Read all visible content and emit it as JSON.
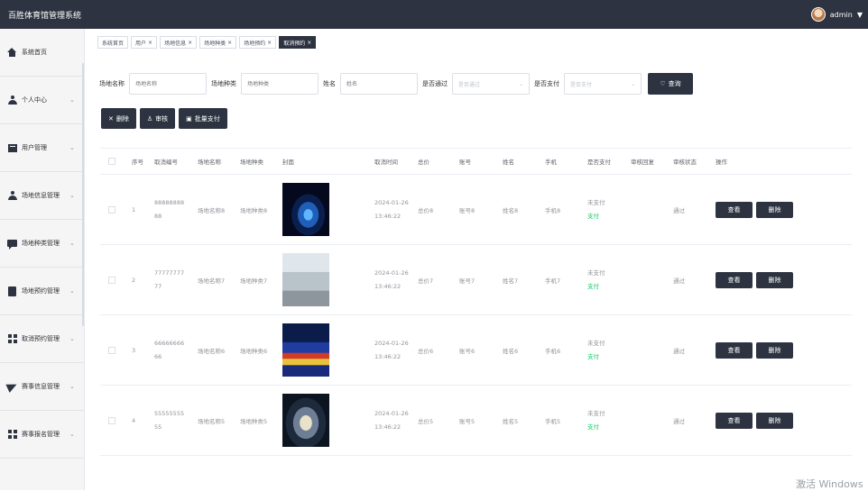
{
  "app": {
    "title": "百胜体育馆管理系统",
    "user": "admin"
  },
  "sidebar": {
    "items": [
      {
        "label": "系统首页",
        "icon": "home-icon"
      },
      {
        "label": "个人中心",
        "icon": "user-icon"
      },
      {
        "label": "用户管理",
        "icon": "folder-icon"
      },
      {
        "label": "场地信息管理",
        "icon": "user-icon"
      },
      {
        "label": "场地种类管理",
        "icon": "chat-icon"
      },
      {
        "label": "场地预约管理",
        "icon": "clipboard-icon"
      },
      {
        "label": "取消预约管理",
        "icon": "grid-icon"
      },
      {
        "label": "赛事信息管理",
        "icon": "send-icon"
      },
      {
        "label": "赛事报名管理",
        "icon": "grid-icon"
      }
    ]
  },
  "tabs": [
    {
      "label": "系统首页",
      "close": ""
    },
    {
      "label": "用户",
      "close": "×"
    },
    {
      "label": "场地信息",
      "close": "×"
    },
    {
      "label": "场地种类",
      "close": "×"
    },
    {
      "label": "场地预约",
      "close": "×"
    },
    {
      "label": "取消预约",
      "close": "×"
    }
  ],
  "search": {
    "venue_name_label": "场地名称",
    "venue_name_placeholder": "场地名称",
    "venue_type_label": "场地种类",
    "venue_type_placeholder": "场地种类",
    "name_label": "姓名",
    "name_placeholder": "姓名",
    "approved_label": "是否通过",
    "approved_placeholder": "是否通过",
    "paid_label": "是否支付",
    "paid_placeholder": "是否支付",
    "button": "查询"
  },
  "actions": {
    "delete": "删除",
    "review": "审核",
    "batch_pay": "批量支付"
  },
  "table": {
    "headers": [
      "序号",
      "取消编号",
      "场地名称",
      "场地种类",
      "封面",
      "取消时间",
      "总价",
      "账号",
      "姓名",
      "手机",
      "是否支付",
      "审核回复",
      "审核状态",
      "操作"
    ],
    "rows": [
      {
        "idx": "1",
        "code": "8888888888",
        "venue": "场地名称8",
        "type": "场地种类8",
        "time": "2024-01-26 13:46:22",
        "price": "总价8",
        "account": "账号8",
        "name": "姓名8",
        "phone": "手机8",
        "paid": "未支付",
        "pay": "支付",
        "reply": "",
        "status": "通过"
      },
      {
        "idx": "2",
        "code": "7777777777",
        "venue": "场地名称7",
        "type": "场地种类7",
        "time": "2024-01-26 13:46:22",
        "price": "总价7",
        "account": "账号7",
        "name": "姓名7",
        "phone": "手机7",
        "paid": "未支付",
        "pay": "支付",
        "reply": "",
        "status": "通过"
      },
      {
        "idx": "3",
        "code": "6666666666",
        "venue": "场地名称6",
        "type": "场地种类6",
        "time": "2024-01-26 13:46:22",
        "price": "总价6",
        "account": "账号6",
        "name": "姓名6",
        "phone": "手机6",
        "paid": "未支付",
        "pay": "支付",
        "reply": "",
        "status": "通过"
      },
      {
        "idx": "4",
        "code": "5555555555",
        "venue": "场地名称5",
        "type": "场地种类5",
        "time": "2024-01-26 13:46:22",
        "price": "总价5",
        "account": "账号5",
        "name": "姓名5",
        "phone": "手机5",
        "paid": "未支付",
        "pay": "支付",
        "reply": "",
        "status": "通过"
      }
    ],
    "row_buttons": {
      "view": "查看",
      "delete": "删除"
    }
  },
  "watermark": "激活 Windows"
}
